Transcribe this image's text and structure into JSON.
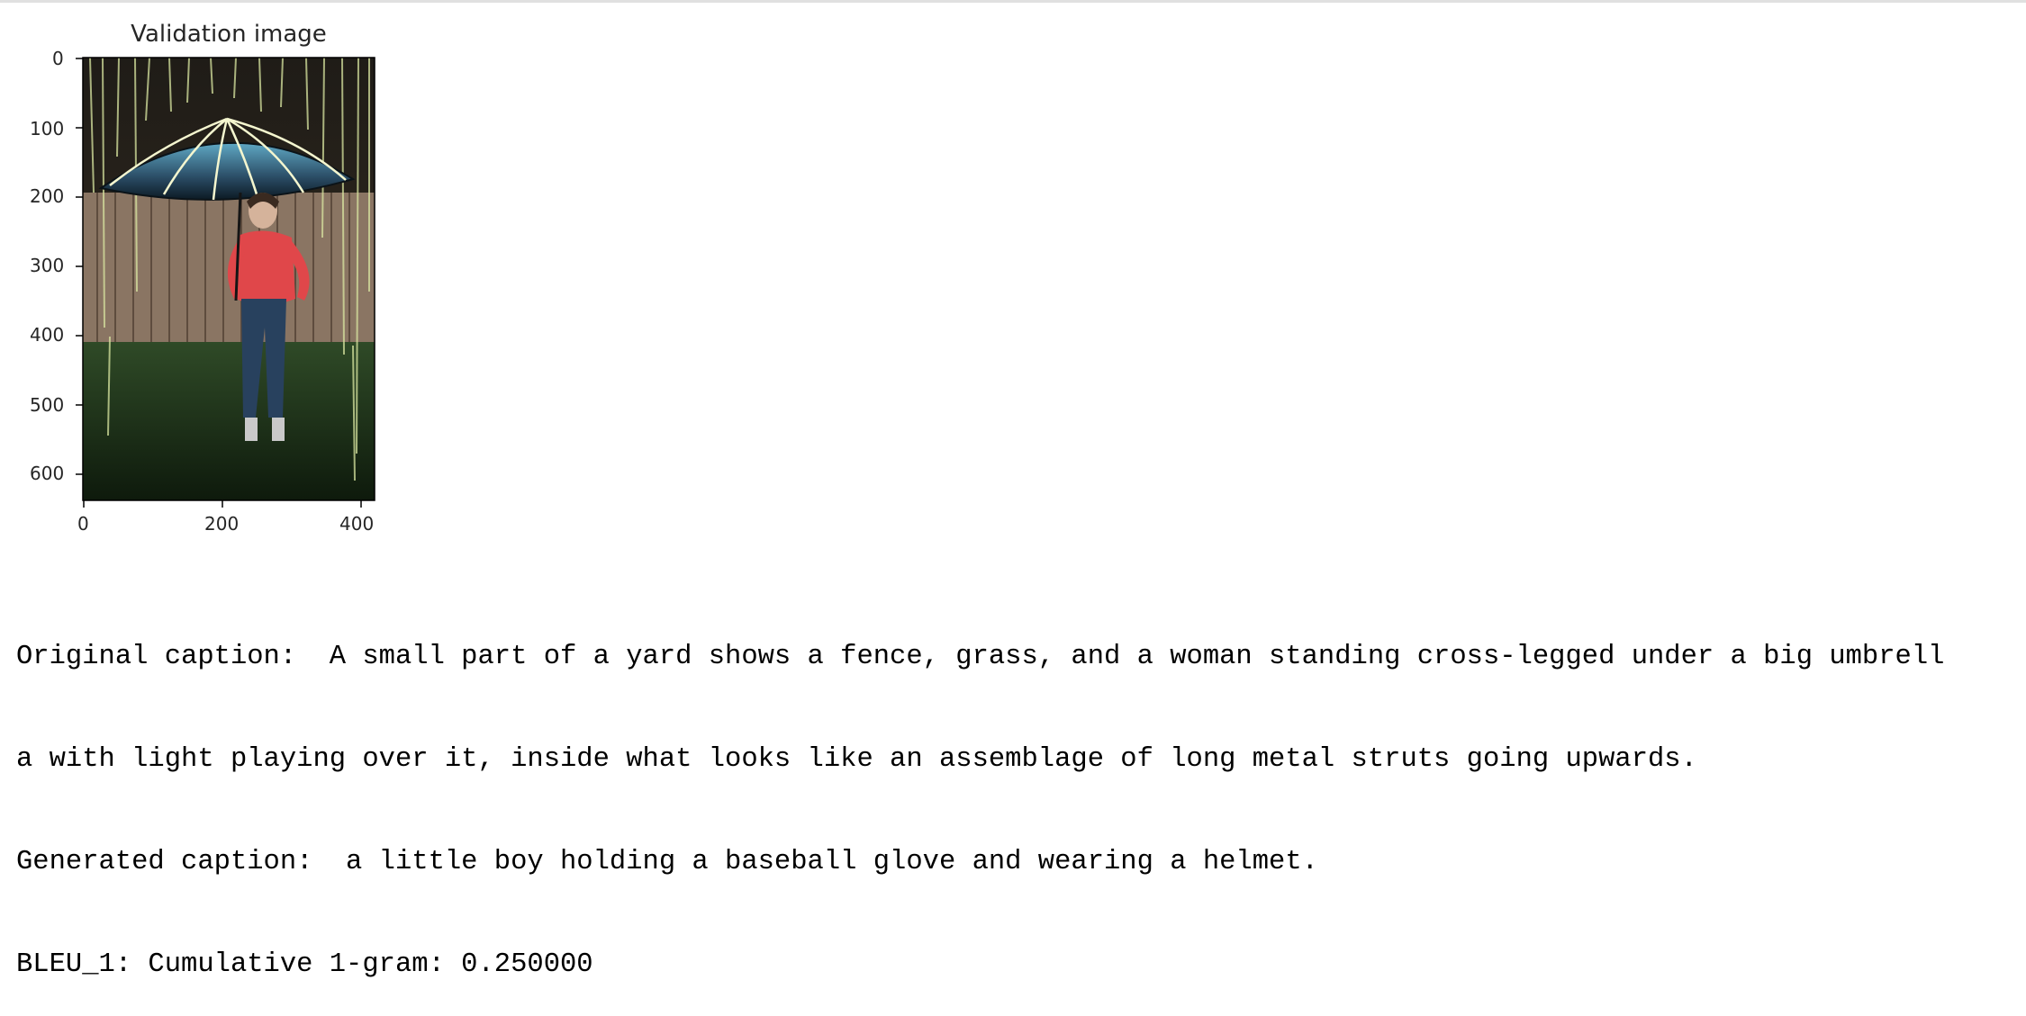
{
  "plot": {
    "title": "Validation image",
    "y_ticks": [
      "0",
      "100",
      "200",
      "300",
      "400",
      "500",
      "600"
    ],
    "x_ticks": [
      "0",
      "200",
      "400"
    ],
    "image_alt": "woman under illuminated umbrella"
  },
  "output": {
    "original_line_1": "Original caption:  A small part of a yard shows a fence, grass, and a woman standing cross-legged under a big umbrell",
    "original_line_2": "a with light playing over it, inside what looks like an assemblage of long metal struts going upwards.",
    "generated": "Generated caption:  a little boy holding a baseball glove and wearing a helmet.",
    "bleu": "BLEU_1: Cumulative 1-gram: 0.250000"
  }
}
